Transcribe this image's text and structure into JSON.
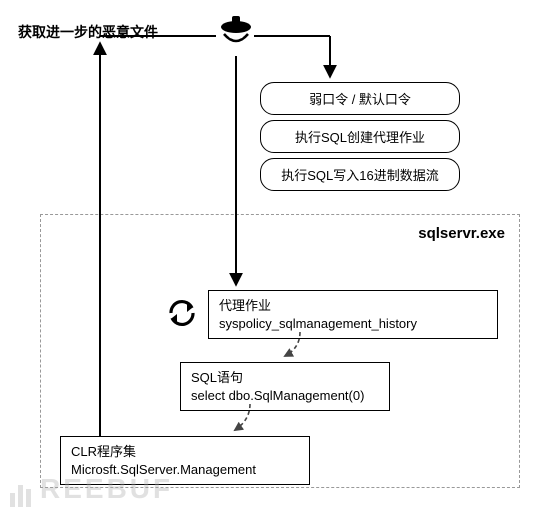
{
  "top_label": "获取进一步的恶意文件",
  "steps": {
    "s1": "弱口令 / 默认口令",
    "s2": "执行SQL创建代理作业",
    "s3": "执行SQL写入16进制数据流"
  },
  "container_title": "sqlservr.exe",
  "job": {
    "title": "代理作业",
    "name": "syspolicy_sqlmanagement_history"
  },
  "sql": {
    "title": "SQL语句",
    "stmt": "select dbo.SqlManagement(0)"
  },
  "clr": {
    "title": "CLR程序集",
    "name": "Microsft.SqlServer.Management"
  },
  "icons": {
    "attacker": "attacker-hat-icon",
    "cycle": "cycle-arrows-icon"
  },
  "watermark": "REEBUF"
}
